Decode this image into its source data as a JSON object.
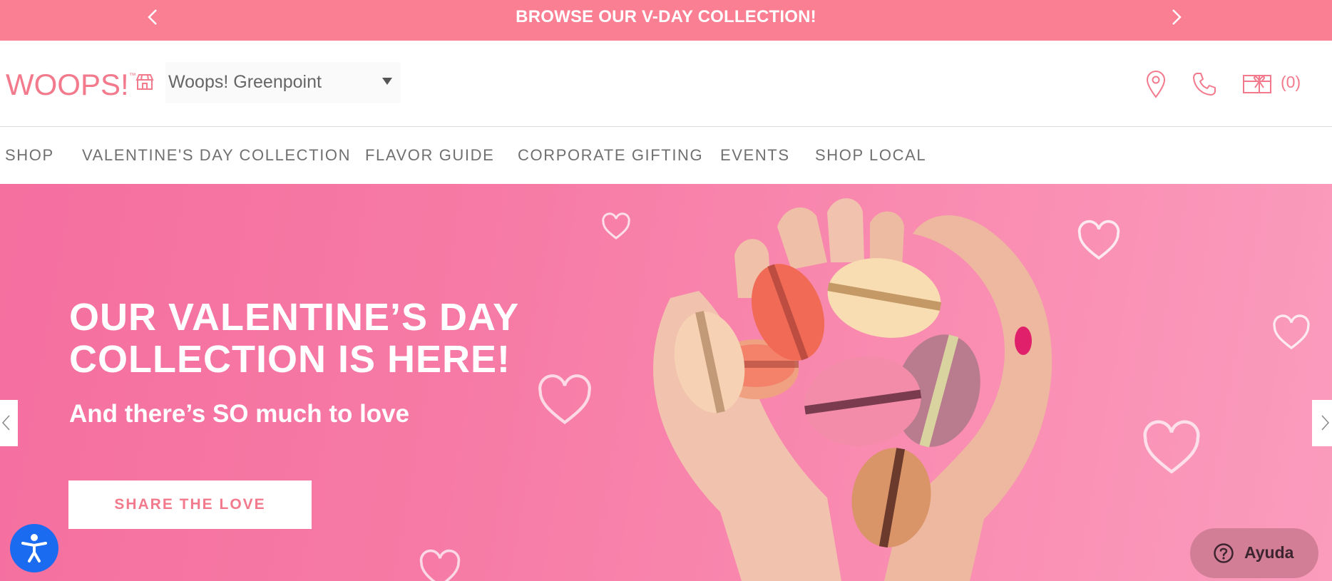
{
  "announcement": {
    "text": "BROWSE OUR V-DAY COLLECTION!",
    "prev_icon": "chevron-left-icon",
    "next_icon": "chevron-right-icon"
  },
  "header": {
    "logo_text": "WOOPS!",
    "logo_mark": "™",
    "store_icon": "store-icon",
    "store_select": {
      "selected": "Woops! Greenpoint"
    },
    "location_icon": "map-pin-icon",
    "phone_icon": "phone-icon",
    "cart_icon": "gift-box-icon",
    "cart_count": "(0)"
  },
  "nav": {
    "items": [
      {
        "label": "SHOP"
      },
      {
        "label": "VALENTINE'S DAY COLLECTION"
      },
      {
        "label": "FLAVOR GUIDE"
      },
      {
        "label": "CORPORATE GIFTING"
      },
      {
        "label": "EVENTS"
      },
      {
        "label": "SHOP LOCAL"
      }
    ]
  },
  "hero": {
    "title_line1": "OUR VALENTINE’S DAY",
    "title_line2": "COLLECTION IS HERE!",
    "subtitle": "And there’s SO much to love",
    "cta_label": "SHARE THE LOVE",
    "prev_icon": "chevron-left-icon",
    "next_icon": "chevron-right-icon"
  },
  "widgets": {
    "accessibility_icon": "accessibility-icon",
    "help_label": "Ayuda",
    "help_icon": "question-circle-icon"
  },
  "colors": {
    "brand_pink": "#f27a8c",
    "announce_bg": "#fb7f92",
    "hero_bg": "#f67aa5",
    "accessibility_blue": "#1a6bf0",
    "help_bg": "#d27e96"
  }
}
